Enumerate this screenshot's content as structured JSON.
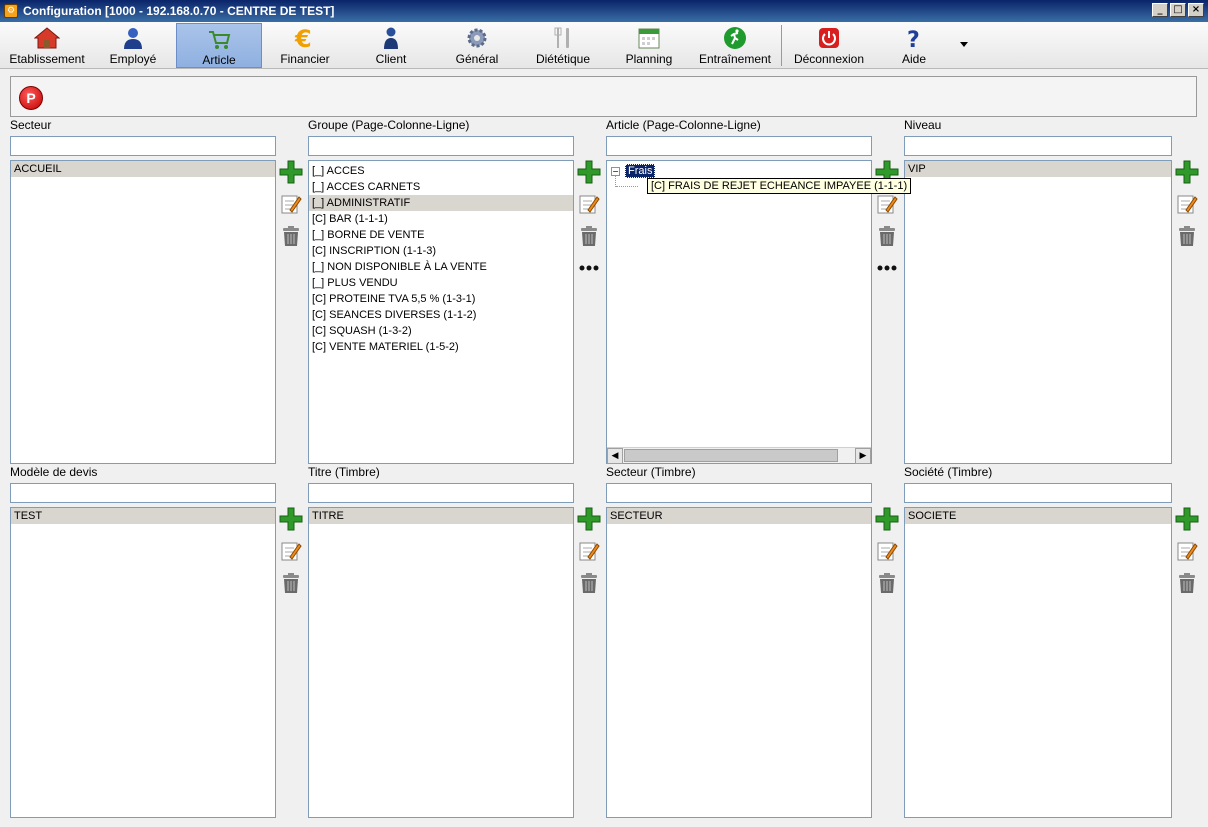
{
  "window": {
    "title": "Configuration [1000 - 192.168.0.70 - CENTRE DE TEST]",
    "controls": [
      "_",
      "□",
      "×"
    ]
  },
  "toolbar": {
    "items": [
      {
        "label": "Etablissement",
        "icon": "home-icon"
      },
      {
        "label": "Employé",
        "icon": "employee-icon"
      },
      {
        "label": "Article",
        "icon": "cart-icon",
        "active": true
      },
      {
        "label": "Financier",
        "icon": "euro-icon"
      },
      {
        "label": "Client",
        "icon": "client-icon"
      },
      {
        "label": "Général",
        "icon": "gear-icon"
      },
      {
        "label": "Diététique",
        "icon": "cutlery-icon"
      },
      {
        "label": "Planning",
        "icon": "calendar-icon"
      },
      {
        "label": "Entraînement",
        "icon": "runner-icon"
      },
      {
        "label": "Déconnexion",
        "icon": "power-icon"
      },
      {
        "label": "Aide",
        "icon": "help-icon"
      }
    ]
  },
  "action_panel": {
    "p_button": "P"
  },
  "sections": {
    "secteur": {
      "label": "Secteur",
      "filter": "",
      "items": [
        "ACCUEIL"
      ],
      "selected": 0
    },
    "groupe": {
      "label": "Groupe (Page-Colonne-Ligne)",
      "filter": "",
      "items": [
        "[_] ACCES",
        "[_] ACCES CARNETS",
        "[_] ADMINISTRATIF",
        "[C] BAR (1-1-1)",
        "[_] BORNE DE VENTE",
        "[C] INSCRIPTION (1-1-3)",
        "[_] NON DISPONIBLE À LA VENTE",
        "[_] PLUS VENDU",
        "[C] PROTEINE TVA 5,5 % (1-3-1)",
        "[C] SEANCES DIVERSES (1-1-2)",
        "[C] SQUASH (1-3-2)",
        "[C] VENTE MATERIEL (1-5-2)"
      ],
      "selected": 2
    },
    "article": {
      "label": "Article (Page-Colonne-Ligne)",
      "filter": "",
      "tree_root": "Frais",
      "tree_toggle": "−",
      "tree_child": "[C] FRAIS DE REJET ECHEANCE IMPAYEE (1-1-1)"
    },
    "niveau": {
      "label": "Niveau",
      "filter": "",
      "items": [
        "VIP"
      ],
      "selected": 0
    },
    "modele_devis": {
      "label": "Modèle de devis",
      "filter": "",
      "items": [
        "TEST"
      ],
      "selected": 0
    },
    "titre": {
      "label": "Titre (Timbre)",
      "filter": "",
      "items": [
        "TITRE"
      ],
      "selected": 0
    },
    "secteur_timbre": {
      "label": "Secteur (Timbre)",
      "filter": "",
      "items": [
        "SECTEUR"
      ],
      "selected": 0
    },
    "societe": {
      "label": "Société (Timbre)",
      "filter": "",
      "items": [
        "SOCIETE"
      ],
      "selected": 0
    }
  },
  "colors": {
    "selection": "#d9d5cf",
    "titlebar": "#0a246a",
    "active_tool": "#aac4ea",
    "tooltip": "#ffffe1"
  }
}
